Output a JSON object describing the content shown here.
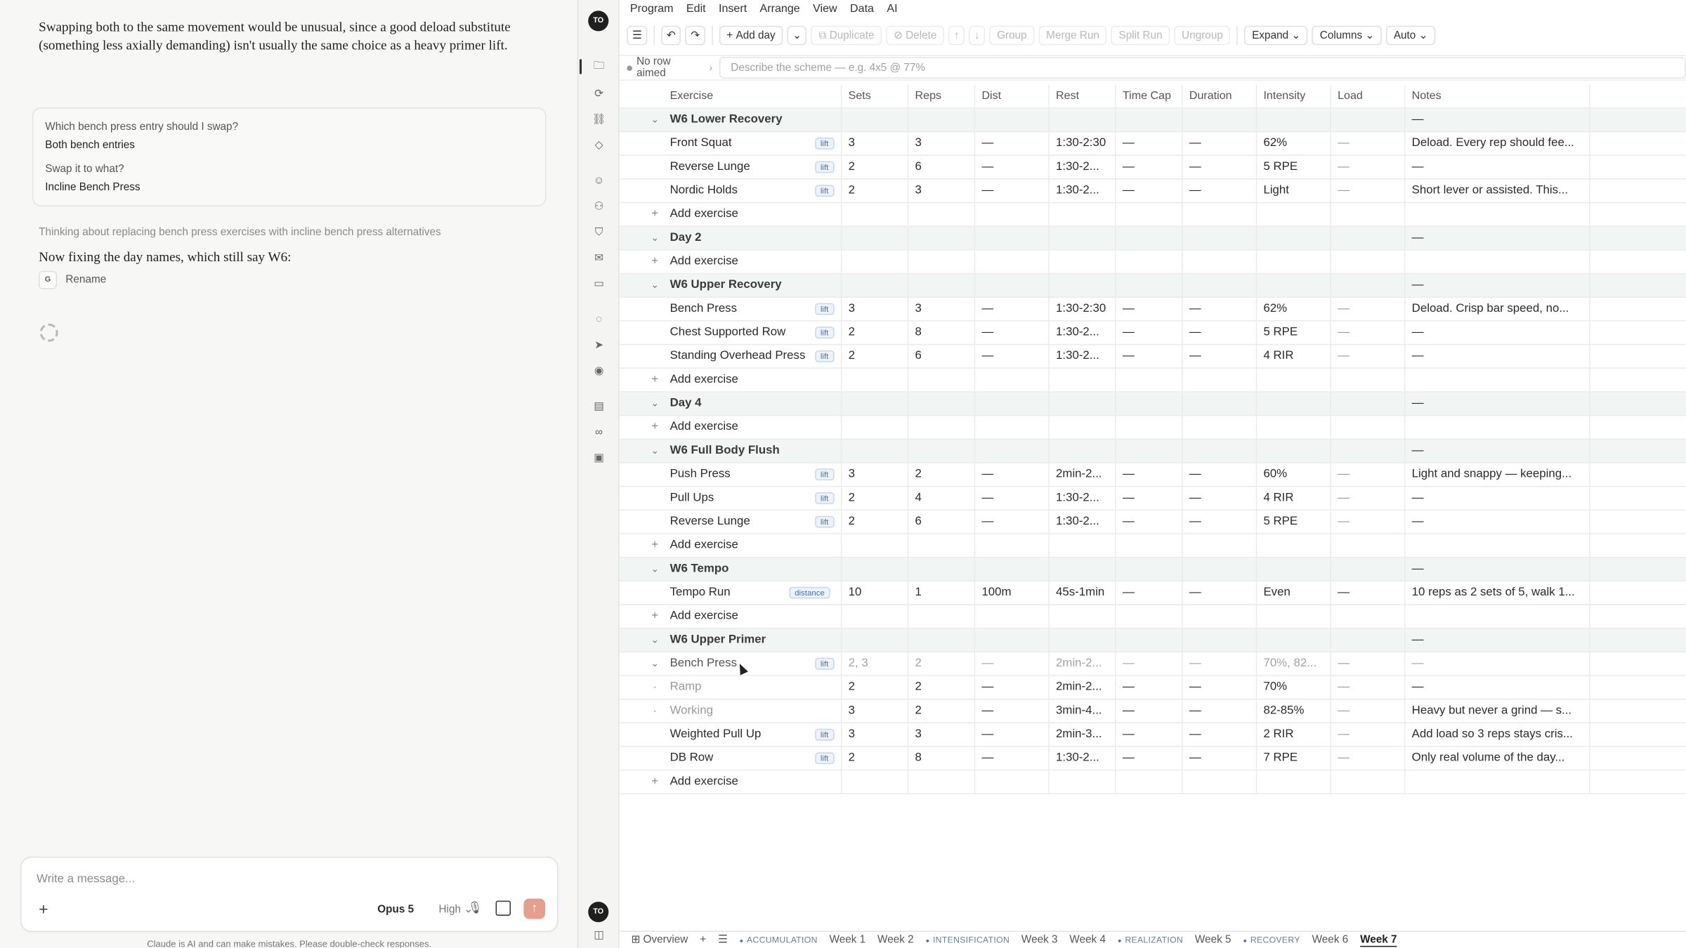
{
  "chat": {
    "intro": "Swapping both to the same movement would be unusual, since a good deload substitute (something less axially demanding) isn't usually the same choice as a heavy primer lift.",
    "qa": [
      {
        "question": "Which bench press entry should I swap?",
        "answer": "Both bench entries"
      },
      {
        "question": "Swap it to what?",
        "answer": "Incline Bench Press"
      }
    ],
    "thinking": "Thinking about replacing bench press exercises with incline bench press alternatives",
    "status": "Now fixing the day names, which still say W6:",
    "tool_chip": "G",
    "tool_name": "Rename",
    "composer_placeholder": "Write a message...",
    "model": "Opus 5",
    "effort": "High",
    "disclaimer": "Claude is AI and can make mistakes. Please double-check responses."
  },
  "rail": {
    "avatar_top": "TO",
    "avatar_bottom": "TO",
    "icons": [
      "folder-icon",
      "flow-icon",
      "link-nodes-icon",
      "tag-icon",
      "users-icon",
      "group-icon",
      "shield-icon",
      "inbox-icon",
      "card-icon",
      "chat-bubbles-icon",
      "send-icon",
      "eye-icon",
      "archive-icon",
      "chain-link-icon",
      "ticket-icon",
      "sidebar-toggle-icon"
    ]
  },
  "menu": [
    "Program",
    "Edit",
    "Insert",
    "Arrange",
    "View",
    "Data",
    "AI"
  ],
  "toolbar": {
    "add_day": "Add day",
    "duplicate": "Duplicate",
    "delete": "Delete",
    "group": "Group",
    "merge_run": "Merge Run",
    "split_run": "Split Run",
    "ungroup": "Ungroup",
    "expand": "Expand",
    "columns": "Columns",
    "auto": "Auto"
  },
  "aim": {
    "label": "No row aimed",
    "placeholder": "Describe the scheme — e.g. 4x5 @ 77%"
  },
  "columns": [
    "Exercise",
    "Sets",
    "Reps",
    "Dist",
    "Rest",
    "Time Cap",
    "Duration",
    "Intensity",
    "Load",
    "Notes"
  ],
  "rows": [
    {
      "kind": "day",
      "toggle": "⌄",
      "exercise": "W6 Lower Recovery",
      "notes": "—"
    },
    {
      "kind": "ex",
      "exercise": "Front Squat",
      "badge": "lift",
      "sets": "3",
      "reps": "3",
      "dist": "—",
      "rest": "1:30-2:30",
      "tcap": "—",
      "dur": "—",
      "int": "62%",
      "load": "—",
      "notes": "Deload. Every rep should fee..."
    },
    {
      "kind": "ex",
      "exercise": "Reverse Lunge",
      "badge": "lift",
      "sets": "2",
      "reps": "6",
      "dist": "—",
      "rest": "1:30-2...",
      "tcap": "—",
      "dur": "—",
      "int": "5 RPE",
      "load": "—",
      "notes": "—"
    },
    {
      "kind": "ex",
      "exercise": "Nordic Holds",
      "badge": "lift",
      "sets": "2",
      "reps": "3",
      "dist": "—",
      "rest": "1:30-2...",
      "tcap": "—",
      "dur": "—",
      "int": "Light",
      "load": "—",
      "notes": "Short lever or assisted. This..."
    },
    {
      "kind": "add",
      "toggle": "+",
      "exercise": "Add exercise"
    },
    {
      "kind": "day",
      "toggle": "⌄",
      "exercise": "Day 2",
      "notes": "—"
    },
    {
      "kind": "add",
      "toggle": "+",
      "exercise": "Add exercise"
    },
    {
      "kind": "day",
      "toggle": "⌄",
      "exercise": "W6 Upper Recovery",
      "notes": "—"
    },
    {
      "kind": "ex",
      "exercise": "Bench Press",
      "badge": "lift",
      "sets": "3",
      "reps": "3",
      "dist": "—",
      "rest": "1:30-2:30",
      "tcap": "—",
      "dur": "—",
      "int": "62%",
      "load": "—",
      "notes": "Deload. Crisp bar speed, no..."
    },
    {
      "kind": "ex",
      "exercise": "Chest Supported Row",
      "badge": "lift",
      "sets": "2",
      "reps": "8",
      "dist": "—",
      "rest": "1:30-2...",
      "tcap": "—",
      "dur": "—",
      "int": "5 RPE",
      "load": "—",
      "notes": "—"
    },
    {
      "kind": "ex",
      "exercise": "Standing Overhead Press",
      "badge": "lift",
      "sets": "2",
      "reps": "6",
      "dist": "—",
      "rest": "1:30-2...",
      "tcap": "—",
      "dur": "—",
      "int": "4 RIR",
      "load": "—",
      "notes": "—"
    },
    {
      "kind": "add",
      "toggle": "+",
      "exercise": "Add exercise"
    },
    {
      "kind": "day",
      "toggle": "⌄",
      "exercise": "Day 4",
      "notes": "—"
    },
    {
      "kind": "add",
      "toggle": "+",
      "exercise": "Add exercise"
    },
    {
      "kind": "day",
      "toggle": "⌄",
      "exercise": "W6 Full Body Flush",
      "notes": "—"
    },
    {
      "kind": "ex",
      "exercise": "Push Press",
      "badge": "lift",
      "sets": "3",
      "reps": "2",
      "dist": "—",
      "rest": "2min-2...",
      "tcap": "—",
      "dur": "—",
      "int": "60%",
      "load": "—",
      "notes": "Light and snappy — keeping..."
    },
    {
      "kind": "ex",
      "exercise": "Pull Ups",
      "badge": "lift",
      "sets": "2",
      "reps": "4",
      "dist": "—",
      "rest": "1:30-2...",
      "tcap": "—",
      "dur": "—",
      "int": "4 RIR",
      "load": "—",
      "notes": "—"
    },
    {
      "kind": "ex",
      "exercise": "Reverse Lunge",
      "badge": "lift",
      "sets": "2",
      "reps": "6",
      "dist": "—",
      "rest": "1:30-2...",
      "tcap": "—",
      "dur": "—",
      "int": "5 RPE",
      "load": "—",
      "notes": "—"
    },
    {
      "kind": "add",
      "toggle": "+",
      "exercise": "Add exercise"
    },
    {
      "kind": "day",
      "toggle": "⌄",
      "exercise": "W6 Tempo",
      "notes": "—"
    },
    {
      "kind": "ex",
      "exercise": "Tempo Run",
      "badge": "distance",
      "sets": "10",
      "reps": "1",
      "dist": "100m",
      "rest": "45s-1min",
      "tcap": "—",
      "dur": "—",
      "int": "Even",
      "load": "—",
      "notes": "10 reps as 2 sets of 5, walk 1..."
    },
    {
      "kind": "add",
      "toggle": "+",
      "exercise": "Add exercise"
    },
    {
      "kind": "day",
      "toggle": "⌄",
      "exercise": "W6 Upper Primer",
      "notes": "—"
    },
    {
      "kind": "dim",
      "toggle": "⌄",
      "exercise": "Bench Press",
      "badge": "lift",
      "sets": "2, 3",
      "reps": "2",
      "dist": "—",
      "rest": "2min-2...",
      "tcap": "—",
      "dur": "—",
      "int": "70%, 82...",
      "load": "—",
      "notes": "—"
    },
    {
      "kind": "sub",
      "toggle": "·",
      "exercise": "Ramp",
      "sets": "2",
      "reps": "2",
      "dist": "—",
      "rest": "2min-2...",
      "tcap": "—",
      "dur": "—",
      "int": "70%",
      "load": "—",
      "notes": "—"
    },
    {
      "kind": "sub",
      "toggle": "·",
      "exercise": "Working",
      "sets": "3",
      "reps": "2",
      "dist": "—",
      "rest": "3min-4...",
      "tcap": "—",
      "dur": "—",
      "int": "82-85%",
      "load": "—",
      "notes": "Heavy but never a grind — s..."
    },
    {
      "kind": "ex",
      "exercise": "Weighted Pull Up",
      "badge": "lift",
      "sets": "3",
      "reps": "3",
      "dist": "—",
      "rest": "2min-3...",
      "tcap": "—",
      "dur": "—",
      "int": "2 RIR",
      "load": "—",
      "notes": "Add load so 3 reps stays cris..."
    },
    {
      "kind": "ex",
      "exercise": "DB Row",
      "badge": "lift",
      "sets": "2",
      "reps": "8",
      "dist": "—",
      "rest": "1:30-2...",
      "tcap": "—",
      "dur": "—",
      "int": "7 RPE",
      "load": "—",
      "notes": "Only real volume of the day..."
    },
    {
      "kind": "add",
      "toggle": "+",
      "exercise": "Add exercise"
    }
  ],
  "tabs": {
    "overview": "Overview",
    "items": [
      {
        "label": "ACCUMULATION",
        "phase": true
      },
      {
        "label": "Week 1"
      },
      {
        "label": "Week 2"
      },
      {
        "label": "INTENSIFICATION",
        "phase": true
      },
      {
        "label": "Week 3"
      },
      {
        "label": "Week 4"
      },
      {
        "label": "REALIZATION",
        "phase": true
      },
      {
        "label": "Week 5"
      },
      {
        "label": "RECOVERY",
        "phase": true
      },
      {
        "label": "Week 6"
      },
      {
        "label": "Week 7",
        "active": true
      }
    ]
  }
}
